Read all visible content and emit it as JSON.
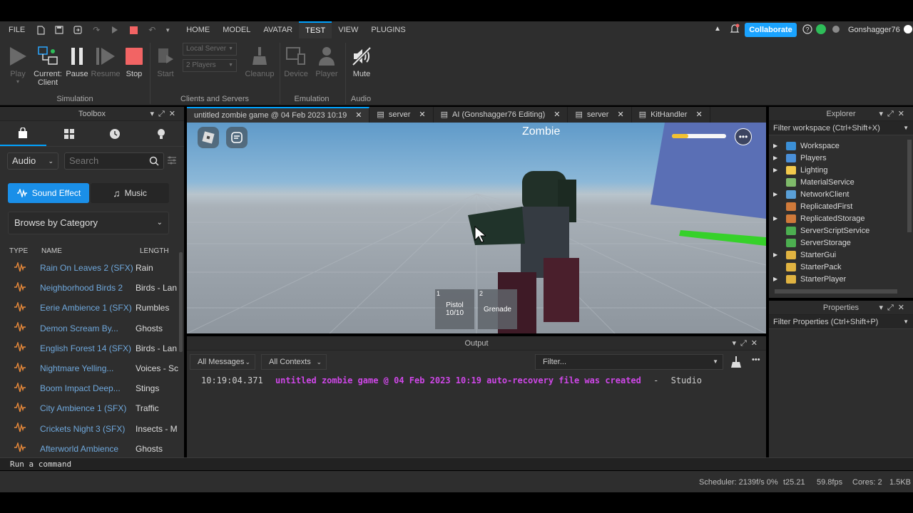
{
  "menu": {
    "file": "FILE",
    "tabs": [
      "HOME",
      "MODEL",
      "AVATAR",
      "TEST",
      "VIEW",
      "PLUGINS"
    ],
    "active_tab": "TEST",
    "collaborate": "Collaborate",
    "username": "Gonshagger76"
  },
  "ribbon": {
    "play": "Play",
    "current_client": "Current:",
    "current_client_2": "Client",
    "pause": "Pause",
    "resume": "Resume",
    "stop": "Stop",
    "start": "Start",
    "local_server": "Local Server",
    "players_count": "2 Players",
    "cleanup": "Cleanup",
    "device": "Device",
    "player": "Player",
    "mute": "Mute",
    "group_simulation": "Simulation",
    "group_clients": "Clients and Servers",
    "group_emulation": "Emulation",
    "group_audio": "Audio"
  },
  "toolbox": {
    "title": "Toolbox",
    "category_select": "Audio",
    "search_placeholder": "Search",
    "sound_effect": "Sound Effect",
    "music": "Music",
    "browse": "Browse by Category",
    "col_type": "TYPE",
    "col_name": "NAME",
    "col_length": "LENGTH",
    "rows": [
      {
        "name": "Rain On Leaves 2 (SFX)",
        "length": "Rain"
      },
      {
        "name": "Neighborhood Birds 2",
        "length": "Birds - Lan"
      },
      {
        "name": "Eerie Ambience 1 (SFX)",
        "length": "Rumbles"
      },
      {
        "name": "Demon Scream By...",
        "length": "Ghosts"
      },
      {
        "name": "English Forest 14 (SFX)",
        "length": "Birds - Lan"
      },
      {
        "name": "Nightmare Yelling...",
        "length": "Voices - Scr"
      },
      {
        "name": "Boom Impact Deep...",
        "length": "Stings"
      },
      {
        "name": "City Ambience 1 (SFX)",
        "length": "Traffic"
      },
      {
        "name": "Crickets Night 3 (SFX)",
        "length": "Insects - M"
      },
      {
        "name": "Afterworld Ambience",
        "length": "Ghosts"
      }
    ]
  },
  "doc_tabs": [
    {
      "label": "untitled zombie game @ 04 Feb 2023 10:19",
      "icon": "none"
    },
    {
      "label": "server",
      "icon": "script-icon"
    },
    {
      "label": "AI (Gonshagger76 Editing)",
      "icon": "script-icon"
    },
    {
      "label": "server",
      "icon": "script-icon"
    },
    {
      "label": "KitHandler",
      "icon": "script-icon"
    }
  ],
  "viewport": {
    "player_name": "Zombie",
    "hotbar": [
      {
        "slot": "1",
        "label": "Pistol",
        "sub": "10/10"
      },
      {
        "slot": "2",
        "label": "Grenade",
        "sub": ""
      }
    ],
    "health_fraction": 0.3
  },
  "output": {
    "title": "Output",
    "messages_filter": "All Messages",
    "contexts_filter": "All Contexts",
    "filter_placeholder": "Filter...",
    "log": {
      "time": "10:19:04.371",
      "message": "untitled zombie game @ 04 Feb 2023 10:19 auto-recovery file was created",
      "sep": "-",
      "source": "Studio"
    }
  },
  "explorer": {
    "title": "Explorer",
    "filter": "Filter workspace (Ctrl+Shift+X)",
    "items": [
      {
        "label": "Workspace",
        "expandable": true,
        "color": "#3b8fd6"
      },
      {
        "label": "Players",
        "expandable": true,
        "color": "#4a90d9"
      },
      {
        "label": "Lighting",
        "expandable": true,
        "color": "#f2c94c"
      },
      {
        "label": "MaterialService",
        "expandable": false,
        "color": "#7fba6a"
      },
      {
        "label": "NetworkClient",
        "expandable": true,
        "color": "#5aa0d8"
      },
      {
        "label": "ReplicatedFirst",
        "expandable": false,
        "color": "#d07a3a"
      },
      {
        "label": "ReplicatedStorage",
        "expandable": true,
        "color": "#d07a3a"
      },
      {
        "label": "ServerScriptService",
        "expandable": false,
        "color": "#4caf50"
      },
      {
        "label": "ServerStorage",
        "expandable": false,
        "color": "#4caf50"
      },
      {
        "label": "StarterGui",
        "expandable": true,
        "color": "#e0b341"
      },
      {
        "label": "StarterPack",
        "expandable": false,
        "color": "#e0b341"
      },
      {
        "label": "StarterPlayer",
        "expandable": true,
        "color": "#e0b341"
      }
    ]
  },
  "properties": {
    "title": "Properties",
    "filter": "Filter Properties (Ctrl+Shift+P)"
  },
  "command_bar": {
    "placeholder": "Run a command"
  },
  "status": {
    "scheduler": "Scheduler: 2139f/s 0%",
    "t": "t25.21",
    "fps": "59.8fps",
    "cores": "Cores: 2",
    "kb": "1.5KB"
  },
  "colors": {
    "accent": "#00a2ff",
    "log_message": "#cf47e8",
    "toolbox_link": "#6fa8dc",
    "waveform": "#e8893a",
    "stop": "#f26464"
  }
}
